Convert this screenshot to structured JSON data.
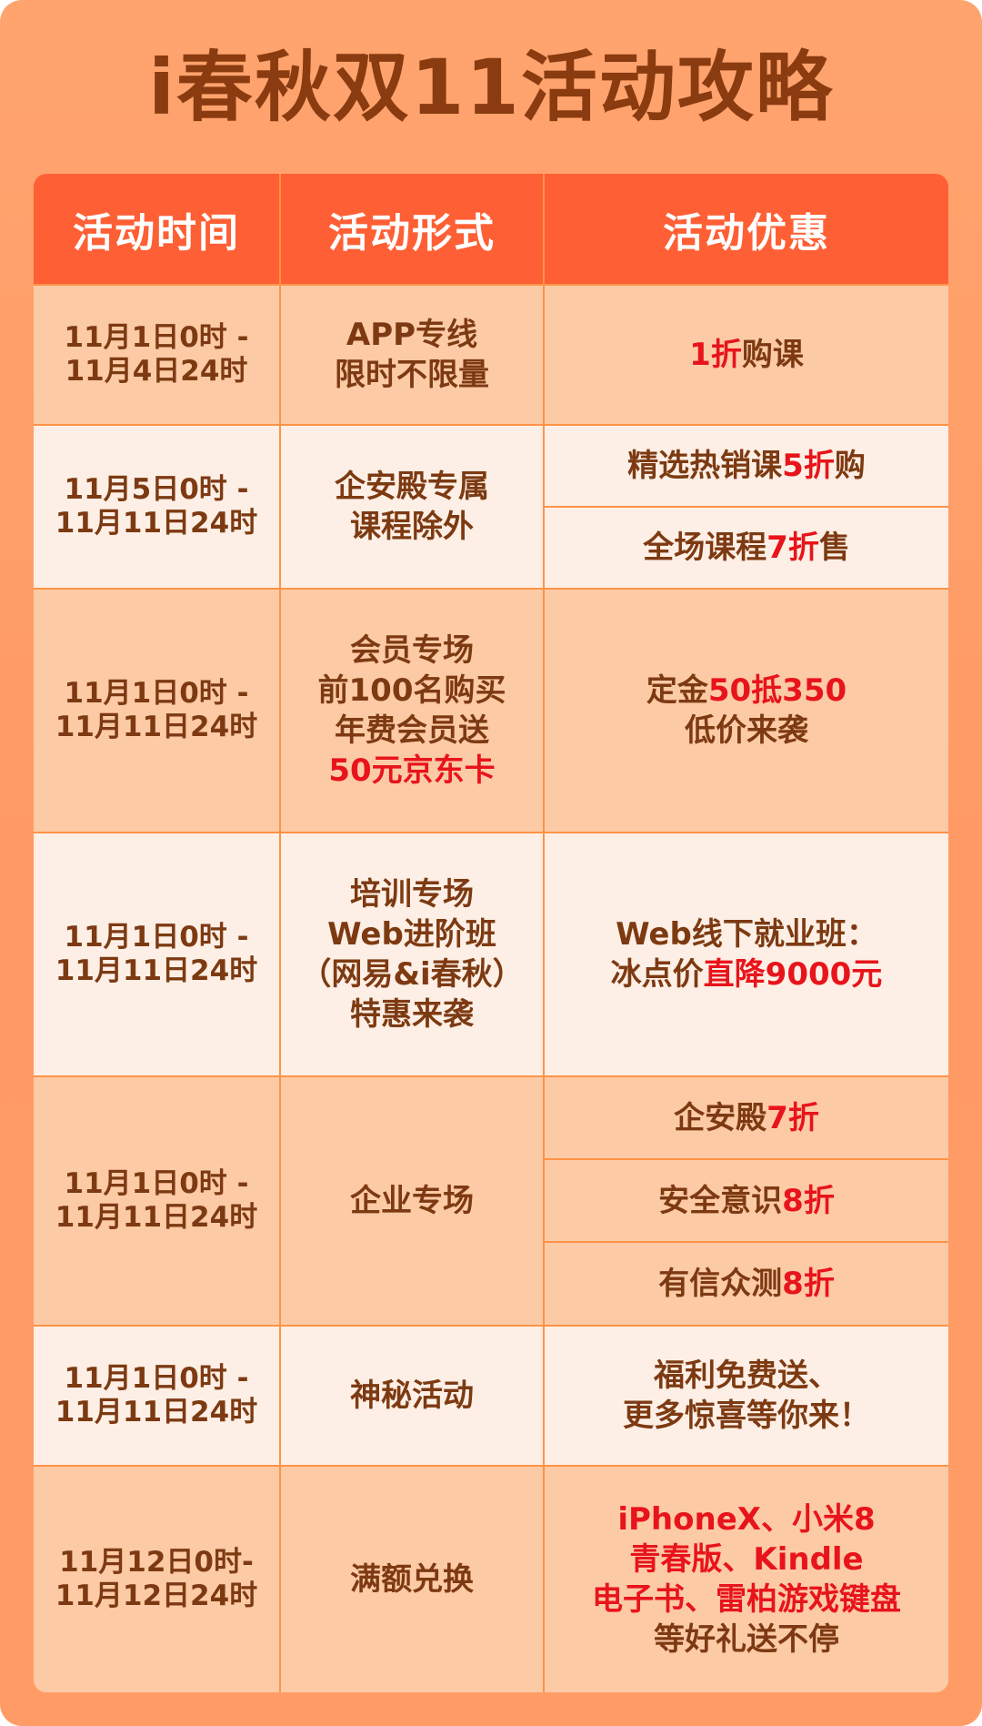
{
  "title": "i春秋双11活动攻略",
  "headers": [
    "活动时间",
    "活动形式",
    "活动优惠"
  ],
  "rows": [
    {
      "time": [
        "11月1日0时 -",
        "11月4日24时"
      ],
      "form": [
        "APP专线",
        "限时不限量"
      ],
      "offers": [
        {
          "parts": [
            {
              "t": "1折",
              "red": true
            },
            {
              "t": "购课",
              "red": false
            }
          ]
        }
      ]
    },
    {
      "time": [
        "11月5日0时 -",
        "11月11日24时"
      ],
      "form": [
        "企安殿专属",
        "课程除外"
      ],
      "offers": [
        {
          "parts": [
            {
              "t": "精选热销课",
              "red": false
            },
            {
              "t": "5折",
              "red": true
            },
            {
              "t": "购",
              "red": false
            }
          ]
        },
        {
          "parts": [
            {
              "t": "全场课程",
              "red": false
            },
            {
              "t": "7折",
              "red": true
            },
            {
              "t": "售",
              "red": false
            }
          ]
        }
      ]
    },
    {
      "time": [
        "11月1日0时 -",
        "11月11日24时"
      ],
      "form": [
        "会员专场",
        "前100名购买",
        "年费会员送"
      ],
      "form_highlight": "50元京东卡",
      "offers": [
        {
          "parts": [
            {
              "t": "定金",
              "red": false
            },
            {
              "t": "50抵350",
              "red": true
            }
          ],
          "line2": "低价来袭"
        }
      ]
    },
    {
      "time": [
        "11月1日0时 -",
        "11月11日24时"
      ],
      "form": [
        "培训专场",
        "Web进阶班",
        "（网易&i春秋）",
        "特惠来袭"
      ],
      "offers": [
        {
          "line1": "Web线下就业班：",
          "parts": [
            {
              "t": "冰点价",
              "red": false
            },
            {
              "t": "直降9000元",
              "red": true
            }
          ]
        }
      ]
    },
    {
      "time": [
        "11月1日0时 -",
        "11月11日24时"
      ],
      "form": [
        "企业专场"
      ],
      "offers": [
        {
          "parts": [
            {
              "t": "企安殿",
              "red": false
            },
            {
              "t": "7折",
              "red": true
            }
          ]
        },
        {
          "parts": [
            {
              "t": "安全意识",
              "red": false
            },
            {
              "t": "8折",
              "red": true
            }
          ]
        },
        {
          "parts": [
            {
              "t": "有信众测",
              "red": false
            },
            {
              "t": "8折",
              "red": true
            }
          ]
        }
      ]
    },
    {
      "time": [
        "11月1日0时 -",
        "11月11日24时"
      ],
      "form": [
        "神秘活动"
      ],
      "offers": [
        {
          "lines": [
            "福利免费送、",
            "更多惊喜等你来！"
          ]
        }
      ]
    },
    {
      "time": [
        "11月12日0时-",
        "11月12日24时"
      ],
      "form": [
        "满额兑换"
      ],
      "offers": [
        {
          "red_lines": [
            "iPhoneX、小米8",
            "青春版、Kindle",
            "电子书、雷柏游戏键盘"
          ],
          "lines": [
            "等好礼送不停"
          ]
        }
      ]
    }
  ],
  "colors": {
    "accent": "#ff5f34",
    "highlight": "#e8141b",
    "text": "#7d3a12"
  }
}
